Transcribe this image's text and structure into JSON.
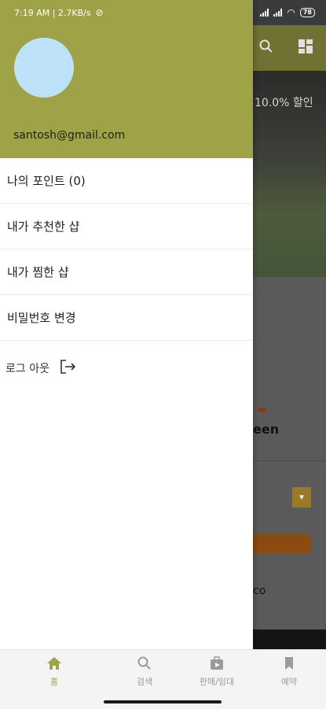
{
  "status_bar": {
    "time_speed": "7:19 AM | 2.7KB/s",
    "battery": "78"
  },
  "drawer": {
    "email": "santosh@gmail.com",
    "menu_items": [
      {
        "label": "나의 포인트 (0)"
      },
      {
        "label": "내가 추천한 샵"
      },
      {
        "label": "내가 찜한 샵"
      },
      {
        "label": "비밀번호 변경"
      }
    ],
    "logout_label": "로그 아웃"
  },
  "background": {
    "hero_text": "10.0% 할인",
    "logo_text": "een",
    "co_text": "co"
  },
  "bottom_nav": {
    "items": [
      {
        "label": "홈",
        "icon": "home-icon",
        "active": true
      },
      {
        "label": "검색",
        "icon": "search-icon"
      },
      {
        "label": "판매/임대",
        "icon": "store-icon"
      },
      {
        "label": "예약",
        "icon": "bookmark-icon"
      }
    ]
  },
  "colors": {
    "accent": "#9fa246",
    "avatar": "#bde2f9"
  }
}
